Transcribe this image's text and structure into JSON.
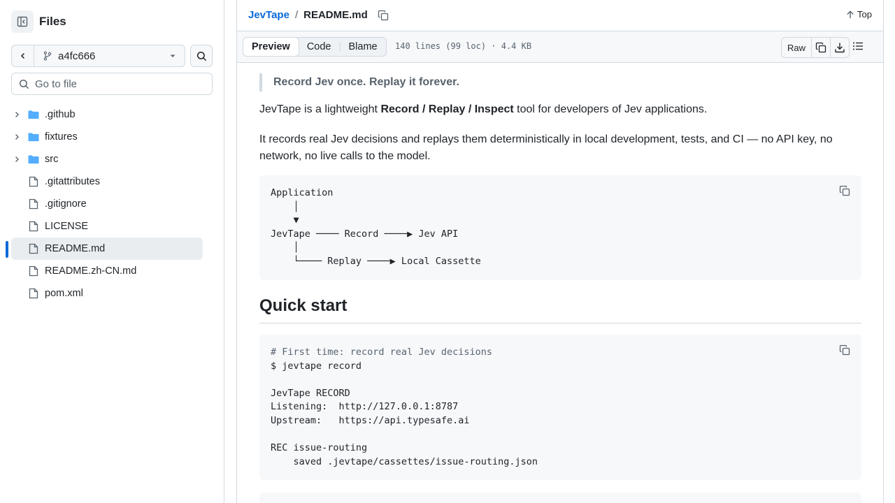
{
  "sidebar": {
    "title": "Files",
    "branch": "a4fc666",
    "goto_placeholder": "Go to file",
    "items": [
      {
        "type": "folder",
        "label": ".github"
      },
      {
        "type": "folder",
        "label": "fixtures"
      },
      {
        "type": "folder",
        "label": "src"
      },
      {
        "type": "file",
        "label": ".gitattributes"
      },
      {
        "type": "file",
        "label": ".gitignore"
      },
      {
        "type": "file",
        "label": "LICENSE"
      },
      {
        "type": "file",
        "label": "README.md",
        "active": true
      },
      {
        "type": "file",
        "label": "README.zh-CN.md"
      },
      {
        "type": "file",
        "label": "pom.xml"
      }
    ]
  },
  "header": {
    "repo": "JevTape",
    "separator": "/",
    "file": "README.md",
    "top_label": "Top"
  },
  "toolbar": {
    "tabs": [
      "Preview",
      "Code",
      "Blame"
    ],
    "selected_tab": "Preview",
    "file_info": "140 lines (99 loc) · 4.4 KB",
    "raw_label": "Raw"
  },
  "readme": {
    "quote": "Record Jev once. Replay it forever.",
    "intro_prefix": "JevTape is a lightweight ",
    "intro_bold": "Record / Replay / Inspect",
    "intro_suffix": " tool for developers of Jev applications.",
    "para2": "It records real Jev decisions and replays them deterministically in local development, tests, and CI — no API key, no network, no live calls to the model.",
    "diagram": "Application\n    │\n    ▼\nJevTape ──── Record ────▶ Jev API\n    │\n    └──── Replay ────▶ Local Cassette",
    "quickstart_heading": "Quick start",
    "quickstart_comment": "# First time: record real Jev decisions",
    "quickstart_code": "$ jevtape record\n\nJevTape RECORD\nListening:  http://127.0.0.1:8787\nUpstream:   https://api.typesafe.ai\n\nREC issue-routing\n    saved .jevtape/cassettes/issue-routing.json"
  },
  "colors": {
    "accent": "#0969da",
    "folder": "#54aeff",
    "border": "#d1d9e0",
    "code_bg": "#f6f8fa"
  }
}
